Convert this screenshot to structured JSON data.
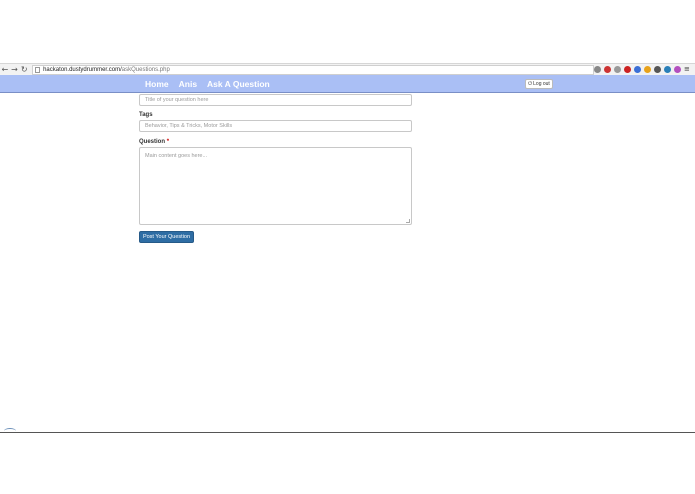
{
  "browser": {
    "url_host": "hackaton.dustydrummer.com/",
    "url_path": "askQuestions.php",
    "back_icon": "back-arrow-icon",
    "forward_icon": "forward-arrow-icon",
    "reload_icon": "reload-icon",
    "extensions": [
      {
        "name": "bookmark-icon",
        "color": "#888888"
      },
      {
        "name": "flag-icon",
        "color": "#cc3333"
      },
      {
        "name": "star-icon",
        "color": "#999999"
      },
      {
        "name": "stop-icon",
        "color": "#cc2222"
      },
      {
        "name": "translate-icon",
        "color": "#3b6fd6"
      },
      {
        "name": "smiley-icon",
        "color": "#e8a21a"
      },
      {
        "name": "recycle-icon",
        "color": "#555555"
      },
      {
        "name": "globe-icon",
        "color": "#2a7fb8"
      },
      {
        "name": "paint-icon",
        "color": "#b34fbf"
      }
    ]
  },
  "nav": {
    "links": [
      "Home",
      "Anis",
      "Ask A Question"
    ],
    "logout_label": "Log out"
  },
  "form": {
    "title_placeholder": "Title of your question here",
    "tags_label": "Tags",
    "tags_placeholder": "Behavior, Tips & Tricks, Motor Skills",
    "question_label": "Question",
    "required_mark": "*",
    "question_placeholder": "Main content goes here...",
    "submit_label": "Post Your Question"
  },
  "colors": {
    "navbar": "#aabff5",
    "submit": "#2e6da4"
  }
}
